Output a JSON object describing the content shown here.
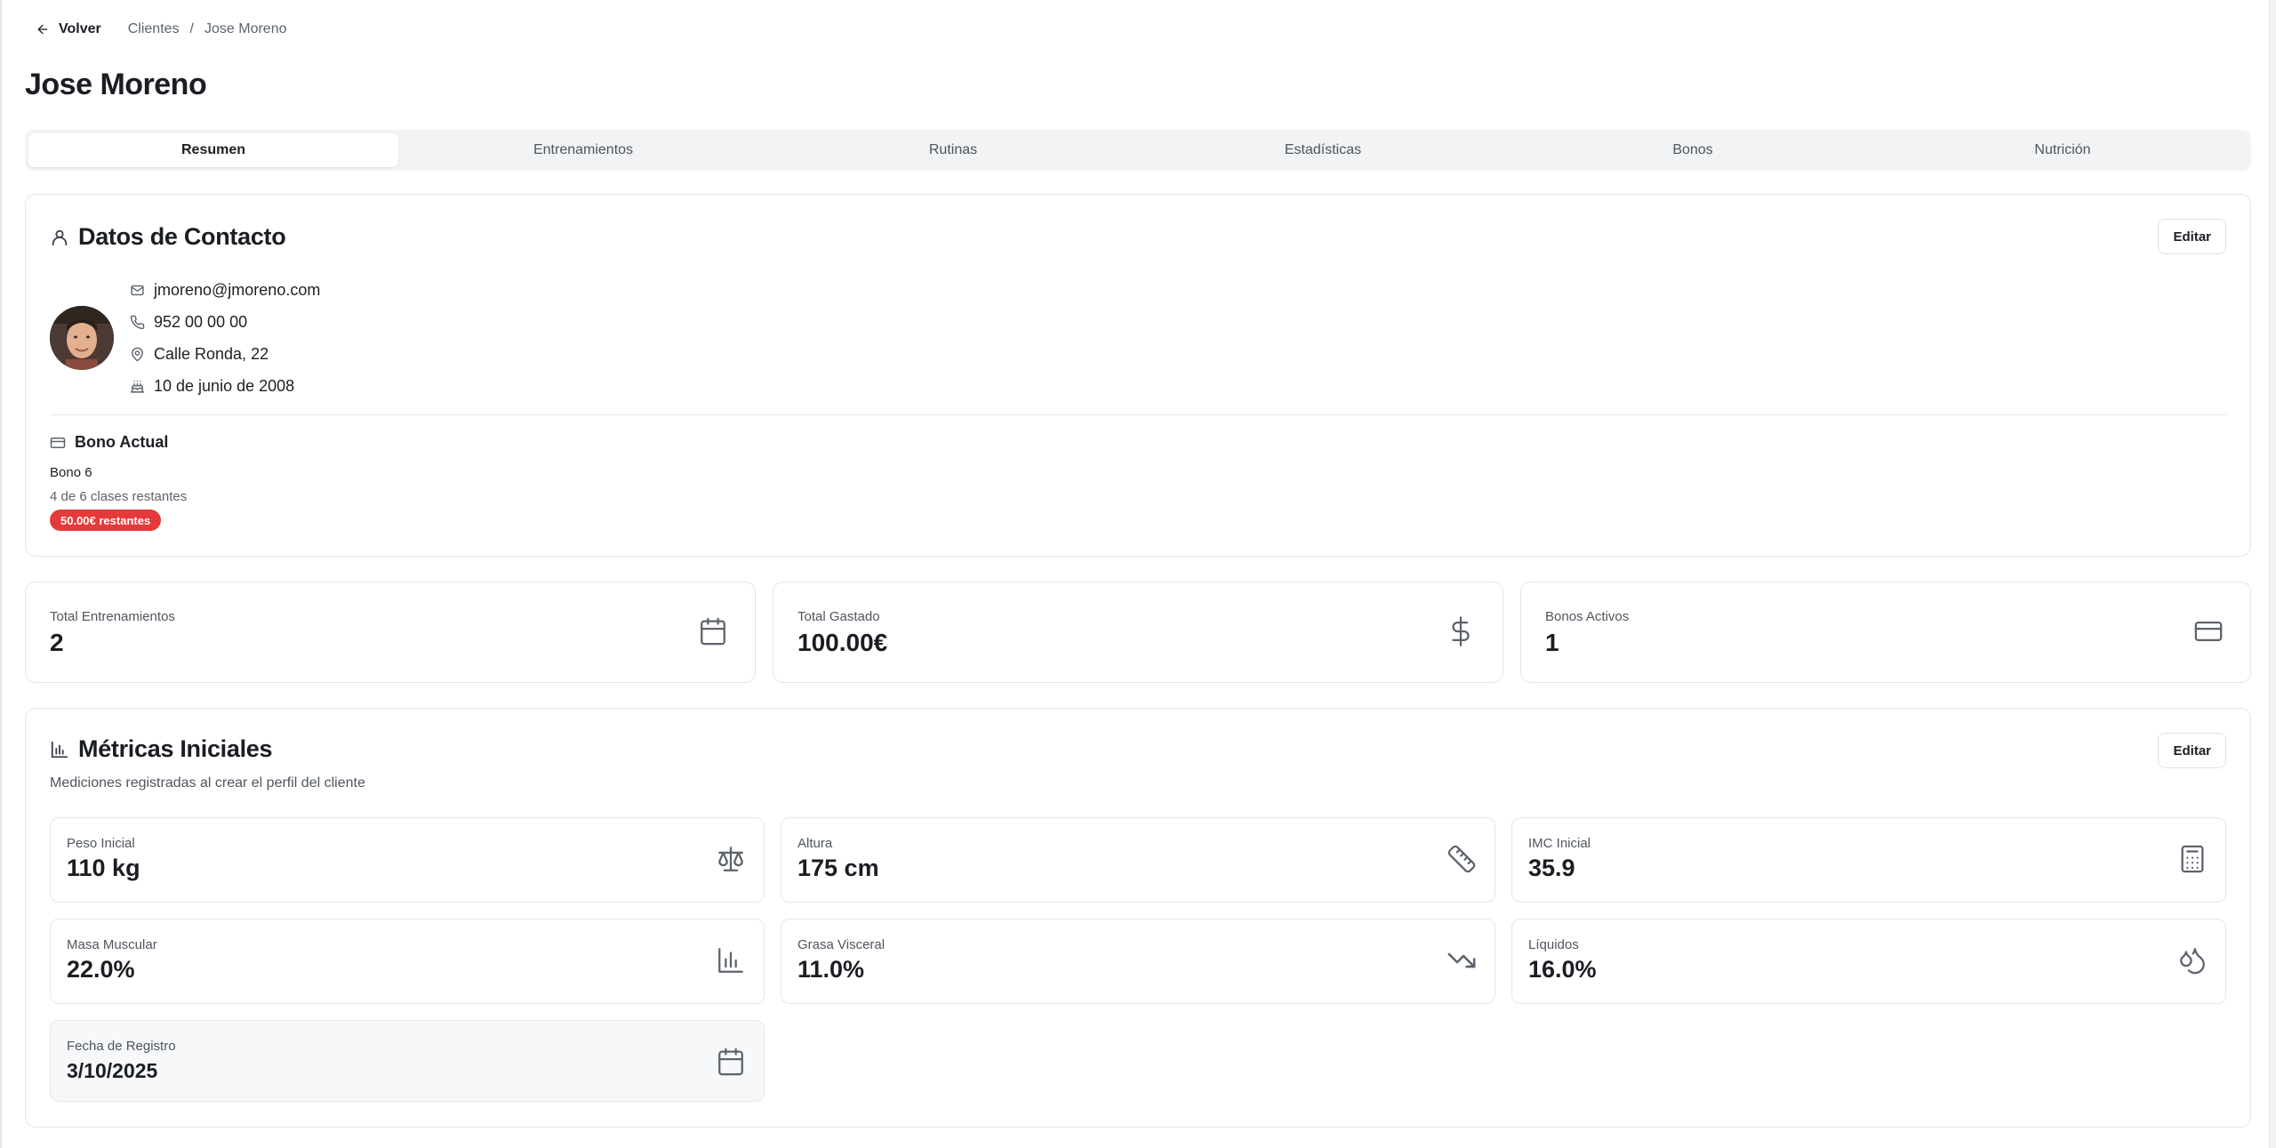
{
  "nav": {
    "back_label": "Volver",
    "crumbs": [
      "Clientes",
      "Jose Moreno"
    ],
    "separator": "/"
  },
  "page": {
    "title": "Jose Moreno"
  },
  "tabs": [
    {
      "label": "Resumen",
      "active": true
    },
    {
      "label": "Entrenamientos"
    },
    {
      "label": "Rutinas"
    },
    {
      "label": "Estadísticas"
    },
    {
      "label": "Bonos"
    },
    {
      "label": "Nutrición"
    }
  ],
  "contact": {
    "title": "Datos de Contacto",
    "edit_label": "Editar",
    "email": "jmoreno@jmoreno.com",
    "phone": "952 00 00 00",
    "address": "Calle Ronda, 22",
    "birthday": "10 de junio de 2008",
    "icons": [
      "user-icon",
      "mail-icon",
      "phone-icon",
      "map-pin-icon",
      "cake-icon"
    ],
    "bono": {
      "heading": "Bono Actual",
      "name": "Bono 6",
      "remaining": "4 de 6 clases restantes",
      "badge": "50.00€ restantes",
      "badge_color": "#e5393a"
    }
  },
  "stats": [
    {
      "label": "Total Entrenamientos",
      "value": "2",
      "icon": "calendar-icon"
    },
    {
      "label": "Total Gastado",
      "value": "100.00€",
      "icon": "dollar-icon"
    },
    {
      "label": "Bonos Activos",
      "value": "1",
      "icon": "credit-card-icon"
    }
  ],
  "metrics": {
    "title": "Métricas Iniciales",
    "subtitle": "Mediciones registradas al crear el perfil del cliente",
    "edit_label": "Editar",
    "items": [
      {
        "label": "Peso Inicial",
        "value": "110 kg",
        "icon": "scale-icon"
      },
      {
        "label": "Altura",
        "value": "175 cm",
        "icon": "ruler-icon"
      },
      {
        "label": "IMC Inicial",
        "value": "35.9",
        "icon": "calculator-icon"
      },
      {
        "label": "Masa Muscular",
        "value": "22.0%",
        "icon": "bar-chart-icon"
      },
      {
        "label": "Grasa Visceral",
        "value": "11.0%",
        "icon": "trending-down-icon"
      },
      {
        "label": "Líquidos",
        "value": "16.0%",
        "icon": "droplets-icon"
      },
      {
        "label": "Fecha de Registro",
        "value": "3/10/2025",
        "icon": "calendar-icon"
      }
    ]
  }
}
